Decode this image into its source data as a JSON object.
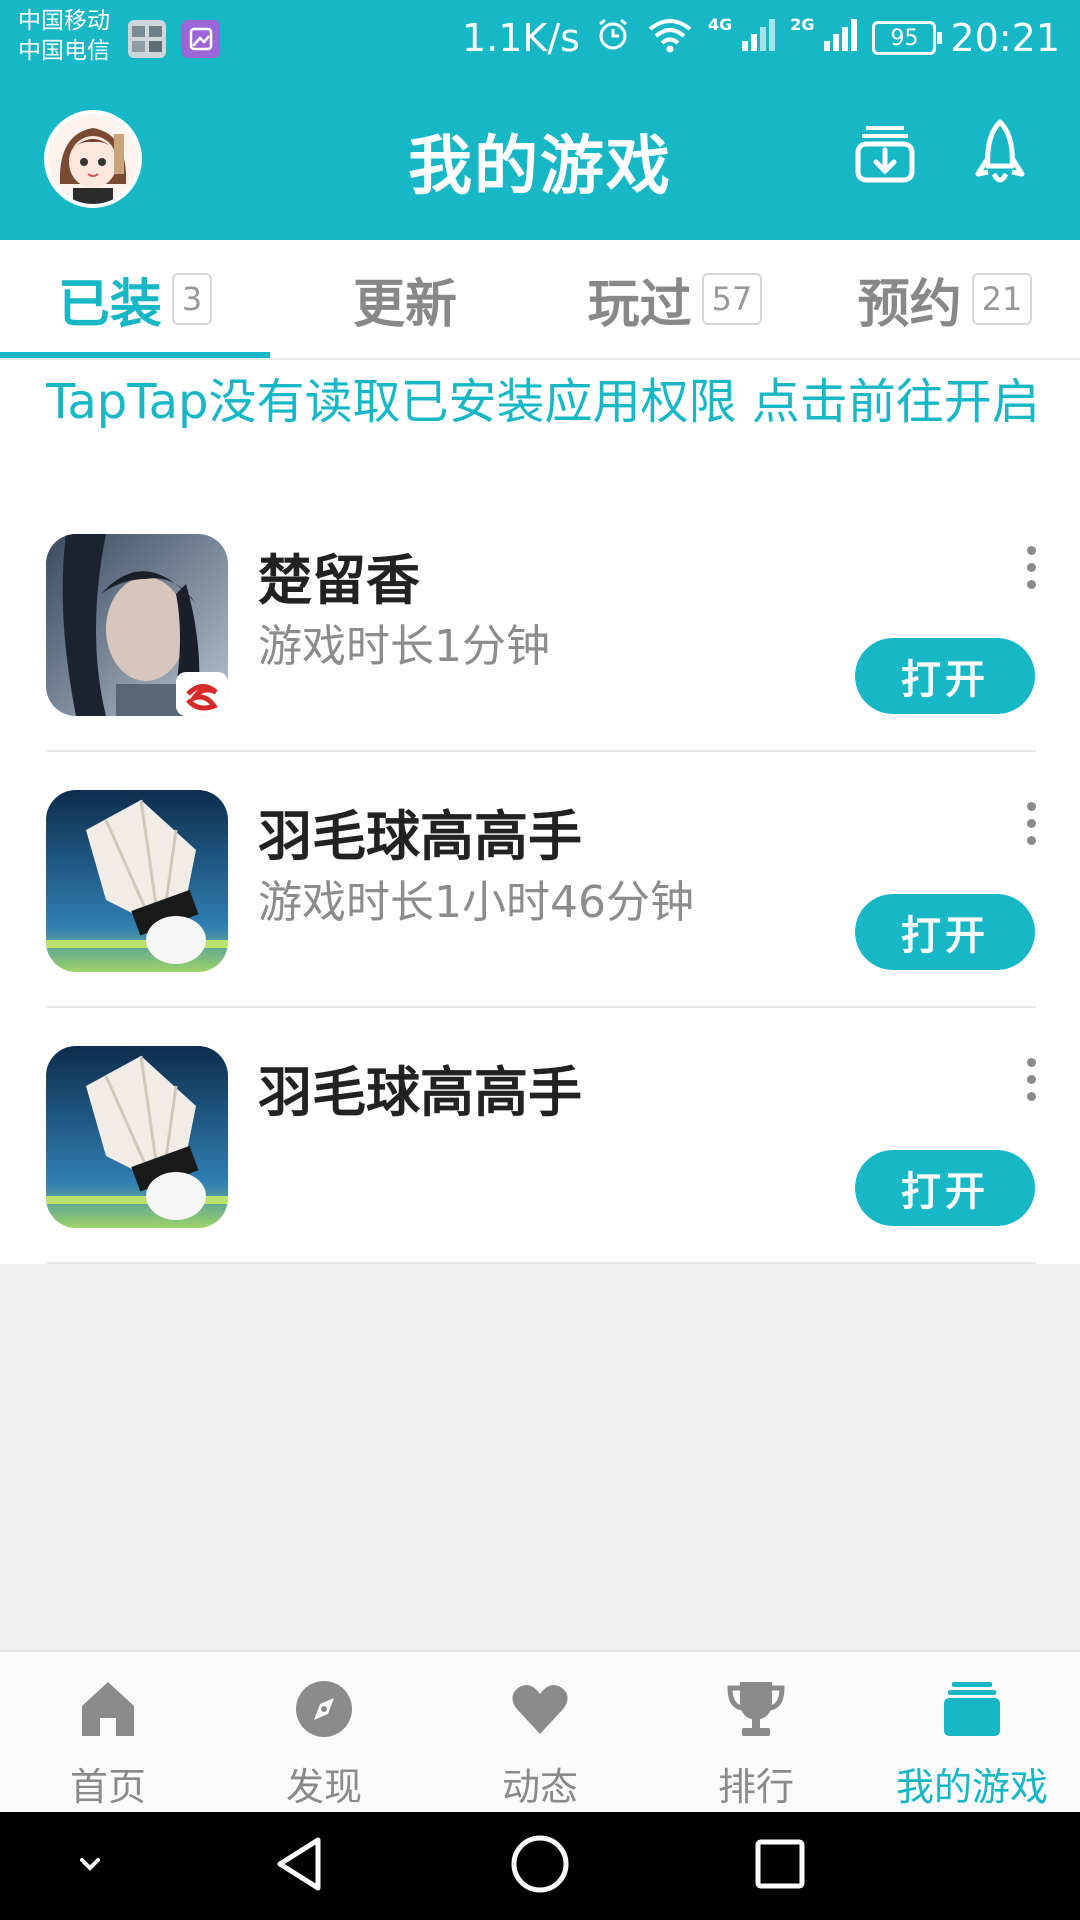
{
  "status_bar": {
    "carrier1": "中国移动",
    "carrier2": "中国电信",
    "net_speed": "1.1K/s",
    "net1": "4G",
    "net2": "2G",
    "battery": "95",
    "time": "20:21"
  },
  "header": {
    "title": "我的游戏",
    "download_icon": "download-icon",
    "rocket_icon": "rocket-icon"
  },
  "tabs": [
    {
      "label": "已装",
      "count": "3",
      "active": true
    },
    {
      "label": "更新",
      "count": ""
    },
    {
      "label": "玩过",
      "count": "57"
    },
    {
      "label": "预约",
      "count": "21"
    }
  ],
  "notice": "TapTap没有读取已安装应用权限 点击前往开启",
  "games": [
    {
      "name": "楚留香",
      "playtime": "游戏时长1分钟",
      "action": "打开"
    },
    {
      "name": "羽毛球高高手",
      "playtime": "游戏时长1小时46分钟",
      "action": "打开"
    },
    {
      "name": "羽毛球高高手",
      "playtime": "",
      "action": "打开"
    }
  ],
  "bottom_nav": [
    {
      "label": "首页",
      "icon": "home-icon"
    },
    {
      "label": "发现",
      "icon": "compass-icon"
    },
    {
      "label": "动态",
      "icon": "heart-icon"
    },
    {
      "label": "排行",
      "icon": "trophy-icon"
    },
    {
      "label": "我的游戏",
      "icon": "games-stack-icon",
      "active": true
    }
  ],
  "colors": {
    "accent": "#17b7c6",
    "text_dark": "#222222",
    "text_muted": "#8c8c8c",
    "background": "#efefef"
  }
}
